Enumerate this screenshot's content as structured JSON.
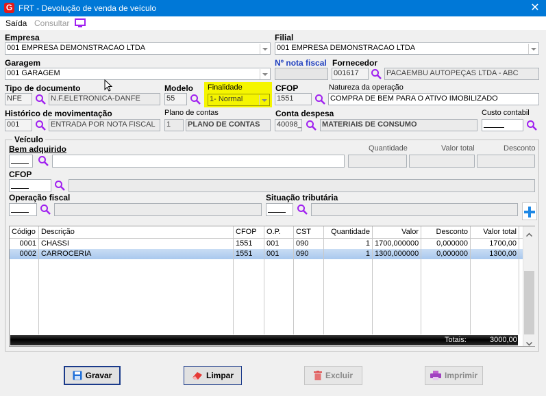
{
  "window": {
    "title": "FRT - Devolução de venda de veículo",
    "logo": "G"
  },
  "menu": {
    "saida": "Saída",
    "consultar": "Consultar"
  },
  "empresa": {
    "label": "Empresa",
    "value": "001 EMPRESA DEMONSTRACAO LTDA"
  },
  "filial": {
    "label": "Filial",
    "value": "001 EMPRESA DEMONSTRACAO LTDA"
  },
  "garagem": {
    "label": "Garagem",
    "value": "001 GARAGEM"
  },
  "nota_fiscal": {
    "label": "Nº nota fiscal",
    "value": ""
  },
  "fornecedor": {
    "label": "Fornecedor",
    "code": "001617",
    "name": "PACAEMBU AUTOPEÇAS LTDA - ABC"
  },
  "tipo_documento": {
    "label": "Tipo de documento",
    "code": "NFE",
    "name": "N.F.ELETRONICA-DANFE"
  },
  "modelo": {
    "label": "Modelo",
    "value": "55"
  },
  "finalidade": {
    "label": "Finalidade",
    "value": "1- Normal"
  },
  "cfop_top": {
    "label": "CFOP",
    "value": "1551"
  },
  "natureza": {
    "label": "Natureza da operação",
    "value": "COMPRA DE BEM PARA O ATIVO IMOBILIZADO"
  },
  "historico": {
    "label": "Histórico de movimentação",
    "code": "001",
    "name": "ENTRADA POR NOTA FISCAL"
  },
  "plano_contas": {
    "label": "Plano de contas",
    "code": "1",
    "name": "PLANO DE CONTAS"
  },
  "conta_despesa": {
    "label": "Conta despesa",
    "code": "40098_",
    "name": "MATERIAIS DE CONSUMO"
  },
  "custo_contabil": {
    "label": "Custo contabil",
    "value": ""
  },
  "veiculo": {
    "group_label": "Veículo",
    "bem_label": "Bem adquirido",
    "quantidade_label": "Quantidade",
    "valor_total_label": "Valor total",
    "desconto_label": "Desconto",
    "cfop_label": "CFOP",
    "operacao_label": "Operação fiscal",
    "situacao_label": "Situação tributária"
  },
  "grid": {
    "columns": [
      "Código",
      "Descrição",
      "CFOP",
      "O.P.",
      "CST",
      "Quantidade",
      "Valor",
      "Desconto",
      "Valor total"
    ],
    "rows": [
      [
        "0001",
        "CHASSI",
        "1551",
        "001",
        "090",
        "1",
        "1700,000000",
        "0,000000",
        "1700,00"
      ],
      [
        "0002",
        "CARROCERIA",
        "1551",
        "001",
        "090",
        "1",
        "1300,000000",
        "0,000000",
        "1300,00"
      ]
    ],
    "selected_row": 1,
    "totals_label": "Totais:",
    "totals_value": "3000,00"
  },
  "buttons": {
    "gravar": "Gravar",
    "limpar": "Limpar",
    "excluir": "Excluir",
    "imprimir": "Imprimir"
  },
  "colors": {
    "titlebar": "#0078d7",
    "magnifier": "#a020f0",
    "finalidade_highlight": "#f5f500",
    "add_button": "#1e88e5"
  }
}
